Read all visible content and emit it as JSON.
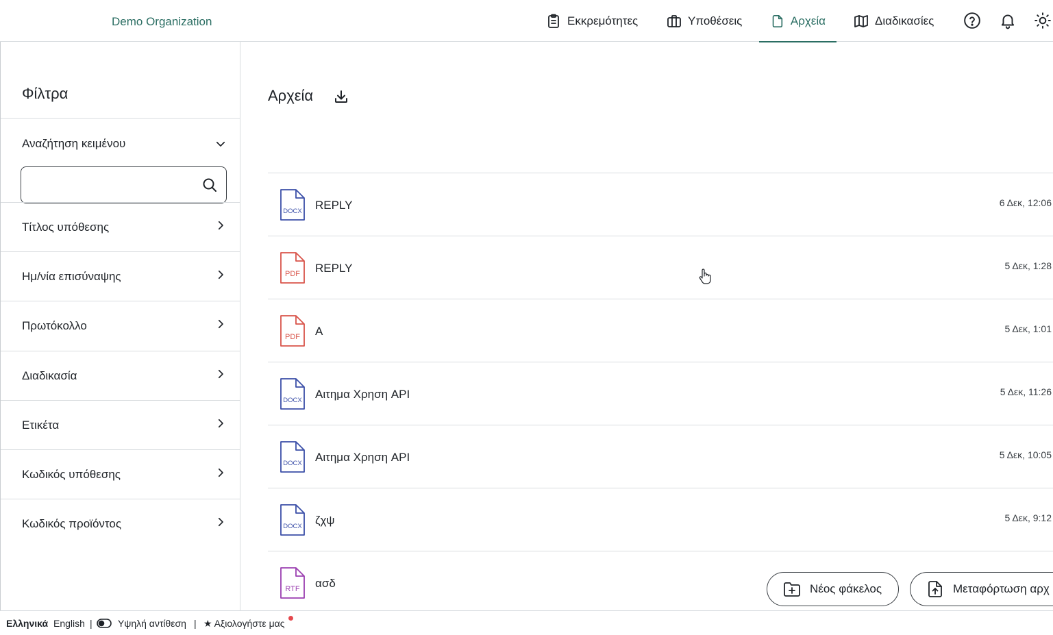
{
  "header": {
    "org_name": "Demo Organization",
    "nav": [
      {
        "label": "Εκκρεμότητες",
        "icon": "clipboard-icon"
      },
      {
        "label": "Υποθέσεις",
        "icon": "briefcase-icon"
      },
      {
        "label": "Αρχεία",
        "icon": "file-icon",
        "active": true
      },
      {
        "label": "Διαδικασίες",
        "icon": "map-icon"
      }
    ],
    "actions": [
      "help-icon",
      "bell-icon",
      "sun-icon"
    ]
  },
  "sidebar": {
    "title": "Φίλτρα",
    "text_search": {
      "label": "Αναζήτηση κειμένου",
      "value": "",
      "placeholder": ""
    },
    "filters": [
      "Τίτλος υπόθεσης",
      "Ημ/νία επισύναψης",
      "Πρωτόκολλο",
      "Διαδικασία",
      "Ετικέτα",
      "Κωδικός υπόθεσης",
      "Κωδικός προϊόντος"
    ]
  },
  "main": {
    "title": "Αρχεία",
    "files": [
      {
        "name": "REPLY",
        "type": "DOCX",
        "date": "6 Δεκ, 12:06"
      },
      {
        "name": "REPLY",
        "type": "PDF",
        "date": "5 Δεκ, 1:28"
      },
      {
        "name": "A",
        "type": "PDF",
        "date": "5 Δεκ, 1:01"
      },
      {
        "name": "Αιτημα Χρηση API",
        "type": "DOCX",
        "date": "5 Δεκ, 11:26"
      },
      {
        "name": "Αιτημα Χρηση API",
        "type": "DOCX",
        "date": "5 Δεκ, 10:05"
      },
      {
        "name": "ζχψ",
        "type": "DOCX",
        "date": "5 Δεκ, 9:12"
      },
      {
        "name": "ασδ",
        "type": "RTF",
        "date": ""
      }
    ],
    "buttons": {
      "new_folder": "Νέος φάκελος",
      "upload": "Μεταφόρτωση αρχ"
    }
  },
  "footer": {
    "lang_greek": "Ελληνικά",
    "lang_english": "English",
    "sep": "|",
    "high_contrast": "Υψηλή αντίθεση",
    "rate": "★ Αξιολογήστε μας"
  },
  "colors": {
    "accent": "#2b6e63",
    "docx": "#3b4fa8",
    "pdf": "#d9544a",
    "rtf": "#9b3fb0"
  }
}
